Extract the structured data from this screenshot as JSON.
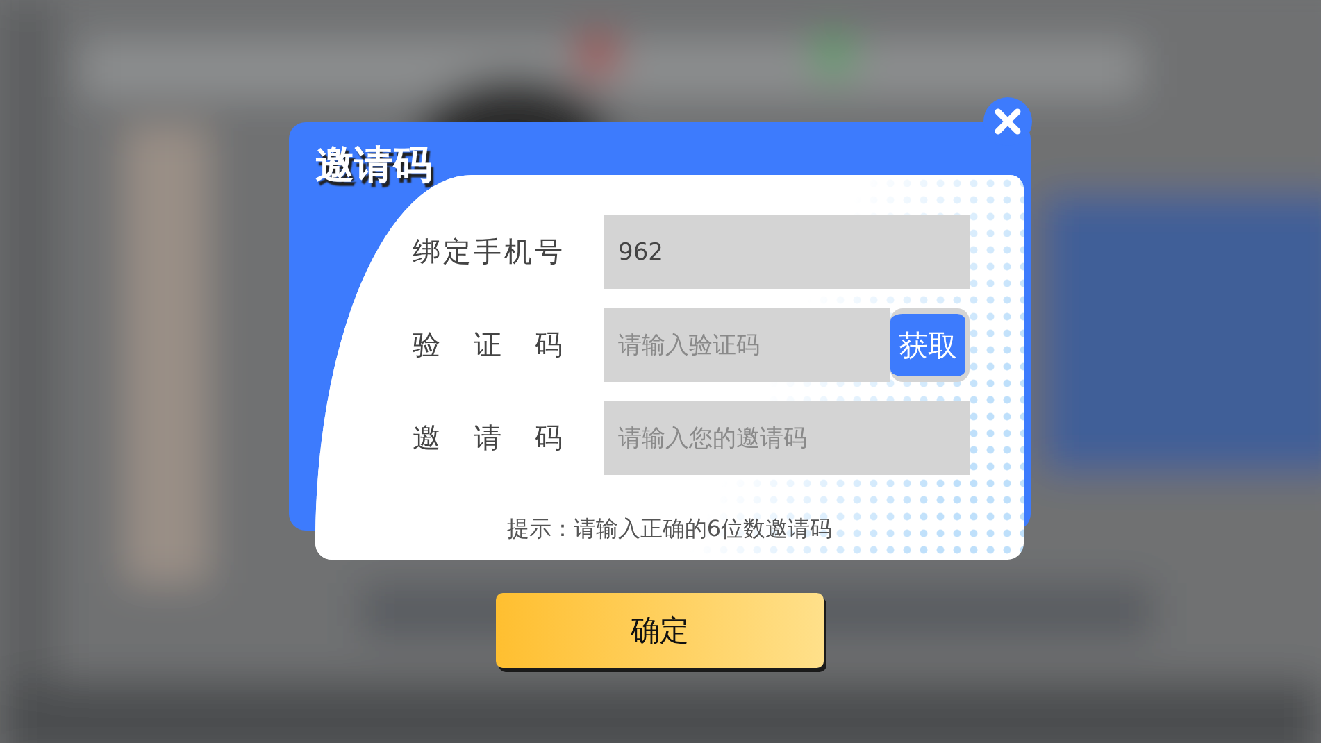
{
  "dialog": {
    "title": "邀请码",
    "fields": [
      {
        "label": "绑定手机号",
        "value": "962"
      },
      {
        "label": "验证码",
        "placeholder": "请输入验证码",
        "button": "获取"
      },
      {
        "label": "邀请码",
        "placeholder": "请输入您的邀请码"
      }
    ],
    "hint": "提示：请输入正确的6位数邀请码"
  },
  "confirm_button": "确定"
}
